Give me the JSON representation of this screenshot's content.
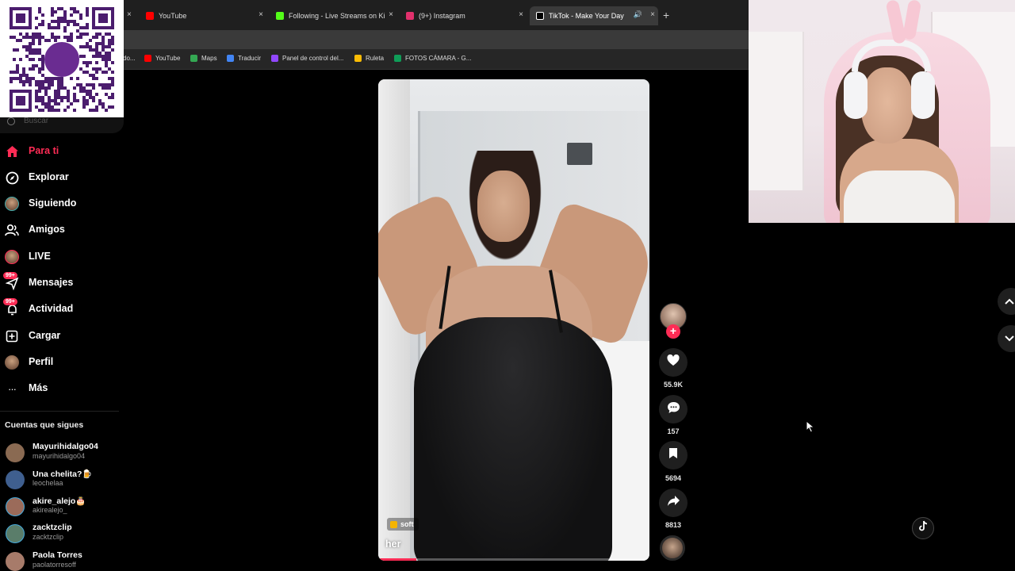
{
  "tabs": [
    {
      "label": "YouTube",
      "color": "#ff0000"
    },
    {
      "label": "Following - Live Streams on Ki",
      "color": "#53fc18"
    },
    {
      "label": "(9+) Instagram",
      "color": "#e1306c"
    },
    {
      "label": "TikTok - Make Your Day",
      "color": "#ffffff",
      "active": true
    }
  ],
  "bookmarks": [
    {
      "label": "do...",
      "color": "#888888"
    },
    {
      "label": "YouTube",
      "color": "#ff0000"
    },
    {
      "label": "Maps",
      "color": "#34a853"
    },
    {
      "label": "Traducir",
      "color": "#4285f4"
    },
    {
      "label": "Panel de control del...",
      "color": "#9147ff"
    },
    {
      "label": "Ruleta",
      "color": "#fbbc05"
    },
    {
      "label": "FOTOS CÁMARA - G...",
      "color": "#0f9d58"
    }
  ],
  "search": {
    "placeholder": "Buscar"
  },
  "nav": {
    "for_you": "Para ti",
    "explore": "Explorar",
    "following": "Siguiendo",
    "friends": "Amigos",
    "live": "LIVE",
    "messages": "Mensajes",
    "messages_badge": "99+",
    "activity": "Actividad",
    "activity_badge": "99+",
    "upload": "Cargar",
    "profile": "Perfil",
    "more": "Más"
  },
  "following_section": {
    "title": "Cuentas que sigues",
    "accounts": [
      {
        "name": "Mayurihidalgo04",
        "handle": "mayurihidalgo04",
        "color": "#8a6a52"
      },
      {
        "name": "Una chelita?🍺",
        "handle": "leochelaa",
        "color": "#3f5f8f"
      },
      {
        "name": "akire_alejo🎂",
        "handle": "akirealejo_",
        "color": "#9b6b5a"
      },
      {
        "name": "zacktzclip",
        "handle": "zacktzclip",
        "color": "#5a7d6a"
      },
      {
        "name": "Paola Torres",
        "handle": "paolatorresoff",
        "color": "#a77b6a"
      }
    ]
  },
  "video": {
    "tag": "soft",
    "caption": "her",
    "progress": 0.14
  },
  "actions": {
    "likes": "55.9K",
    "comments": "157",
    "saves": "5694",
    "shares": "8813"
  },
  "colors": {
    "accent": "#fe2c55",
    "background": "#000000"
  }
}
